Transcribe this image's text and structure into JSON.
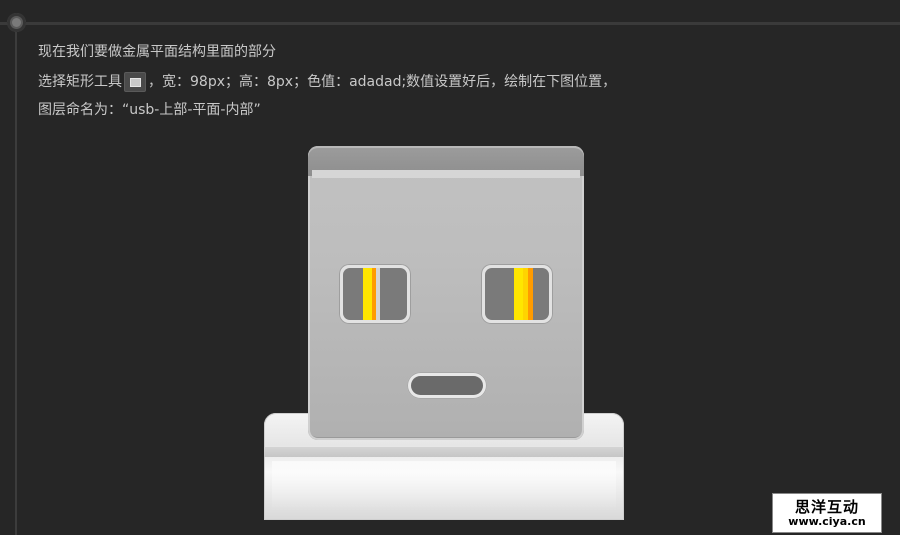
{
  "tutorial": {
    "line1": "现在我们要做金属平面结构里面的部分",
    "line2_before_icon": "选择矩形工具",
    "line2_after_icon": "，宽：98px；高：8px；色值：adadad;数值设置好后，绘制在下图位置，",
    "line3": "图层命名为：“usb-上部-平面-内部”",
    "tool_icon": "rectangle-tool-icon"
  },
  "watermark": {
    "name": "思洋互动",
    "url": "www.ciya.cn"
  },
  "colors": {
    "background": "#262626",
    "text": "#c8c8c8",
    "stripe_yellow": "#ffe600",
    "stripe_orange": "#ff9b00"
  }
}
